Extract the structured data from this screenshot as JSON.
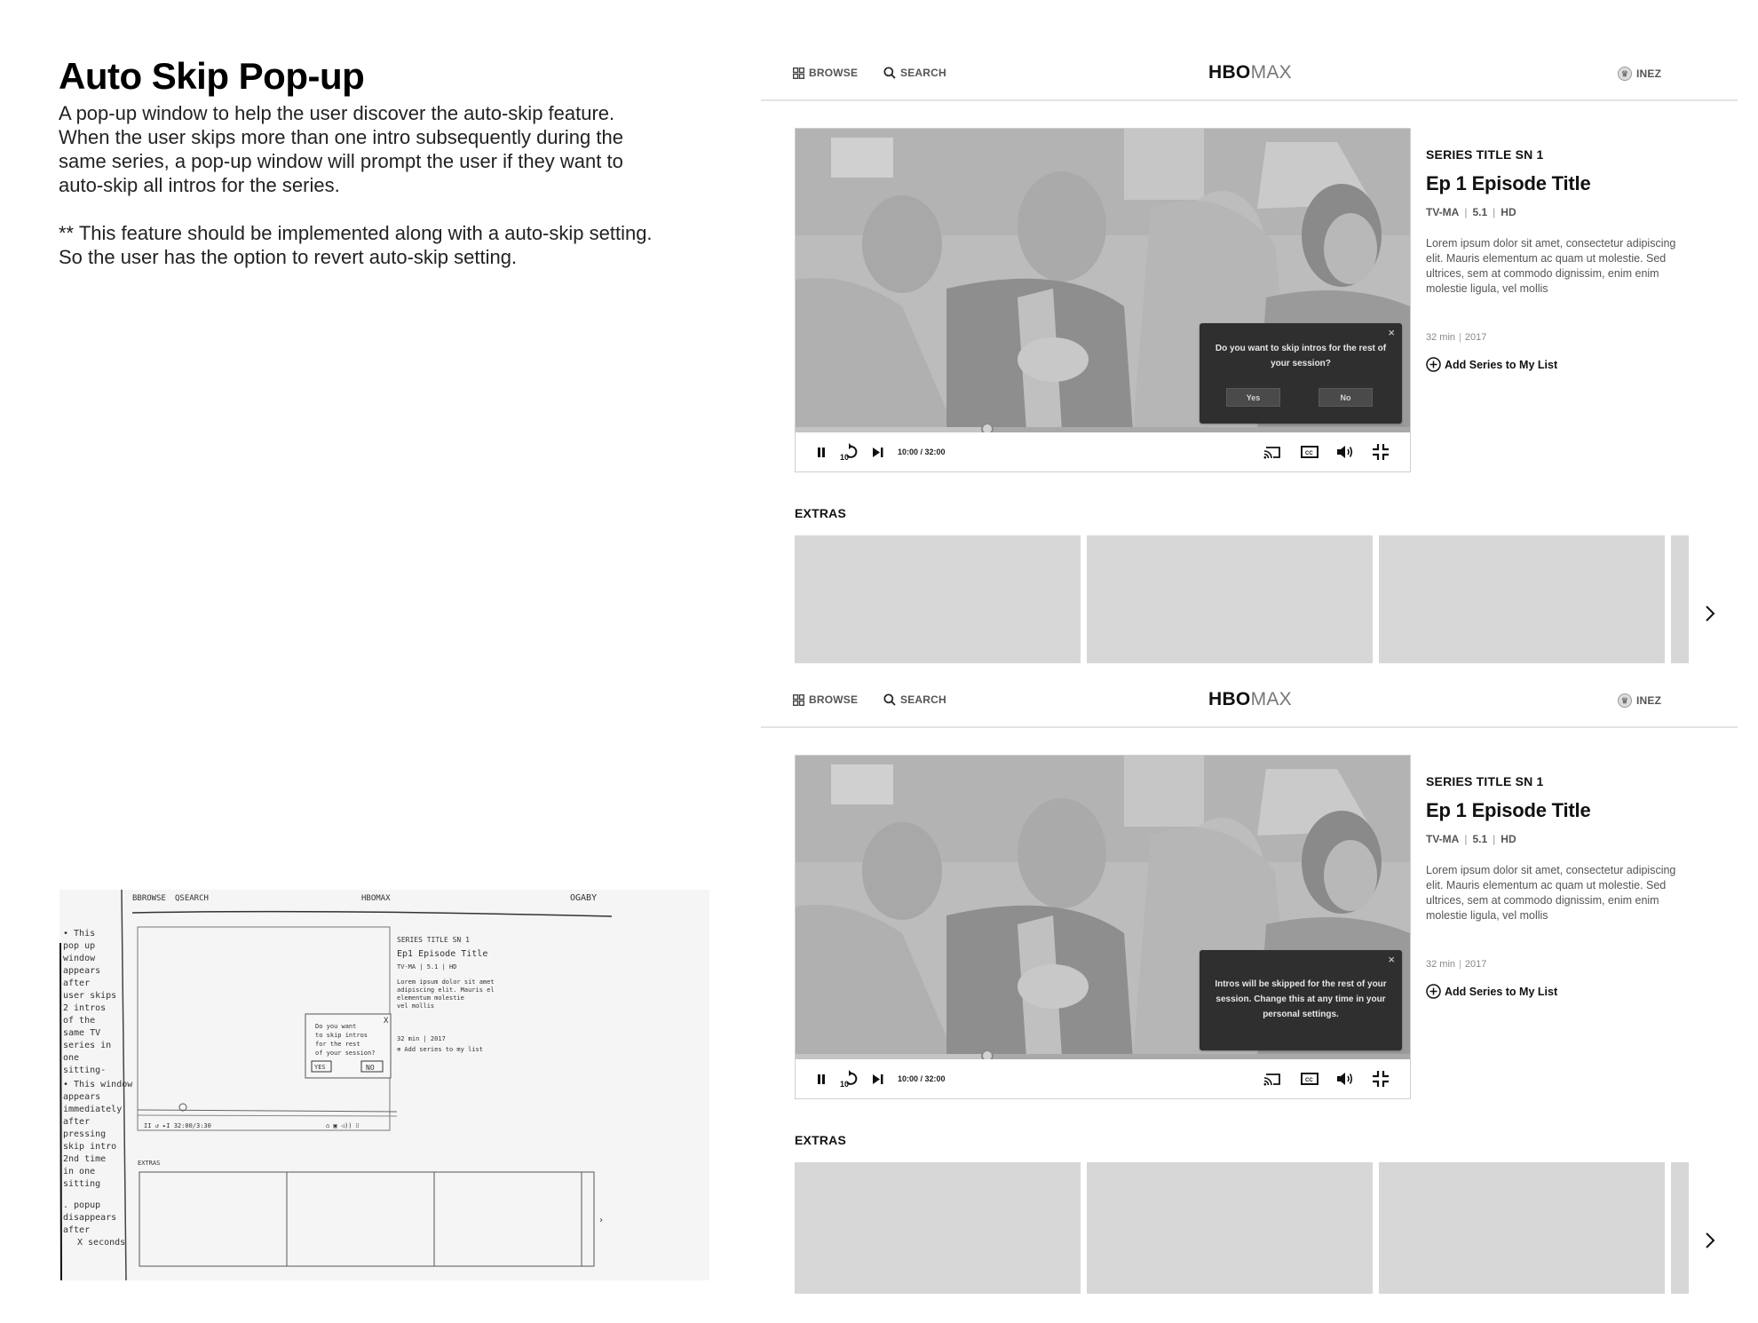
{
  "description": {
    "title": "Auto Skip Pop-up",
    "body": "A pop-up window to help the user discover the auto-skip feature. When the user skips more than one intro subsequently during the same series, a pop-up window will prompt the user if they want to auto-skip all intros for the series.",
    "note": "** This feature should be implemented along with a auto-skip setting. So the user has the option to revert auto-skip setting."
  },
  "sketch": {
    "nav": [
      "BBROWSE",
      "QSEARCH",
      "HBOMAX",
      "OGABY"
    ],
    "notes": [
      "• This pop up window appears after user skips 2 intros of the same TV series in one sitting-",
      "• This window appears immediately after pressing skip intro 2nd time in one sitting",
      "• popup disappears after X seconds"
    ],
    "popup_text": "Do you want to skip intros for the rest of your session?",
    "popup_yes": "YES",
    "popup_no": "NO",
    "extras": "EXTRAS"
  },
  "mockups": [
    {
      "nav": {
        "browse": "BROWSE",
        "search": "SEARCH",
        "logo_bold": "HBO",
        "logo_light": "MAX",
        "user": "INEZ"
      },
      "player": {
        "time": "10:00 / 32:00",
        "progress_fraction": 0.3125,
        "icons": [
          "pause-icon",
          "replay-10-icon",
          "skip-next-icon",
          "cast-icon",
          "closed-captions-icon",
          "volume-icon",
          "exit-fullscreen-icon"
        ]
      },
      "popup": {
        "type": "prompt",
        "message": "Do you want to skip intros for the rest of your session?",
        "yes": "Yes",
        "no": "No",
        "close": "×"
      },
      "info": {
        "series": "SERIES TITLE SN 1",
        "episode": "Ep 1 Episode Title",
        "rating": "TV-MA",
        "audio": "5.1",
        "quality": "HD",
        "synopsis": "Lorem ipsum dolor sit amet, consectetur adipiscing elit. Mauris elementum ac quam ut molestie. Sed ultrices, sem at commodo dignissim, enim enim molestie ligula, vel mollis",
        "runtime": "32 min",
        "year": "2017",
        "add_list": "Add Series to My List"
      },
      "extras": {
        "label": "EXTRAS",
        "tile_count": 4
      }
    },
    {
      "nav": {
        "browse": "BROWSE",
        "search": "SEARCH",
        "logo_bold": "HBO",
        "logo_light": "MAX",
        "user": "INEZ"
      },
      "player": {
        "time": "10:00 / 32:00",
        "progress_fraction": 0.3125
      },
      "popup": {
        "type": "confirmation",
        "message": "Intros will be skipped for the rest of your session. Change this at any time in your personal settings.",
        "close": "×"
      },
      "info": {
        "series": "SERIES TITLE SN 1",
        "episode": "Ep 1 Episode Title",
        "rating": "TV-MA",
        "audio": "5.1",
        "quality": "HD",
        "synopsis": "Lorem ipsum dolor sit amet, consectetur adipiscing elit. Mauris elementum ac quam ut molestie. Sed ultrices, sem at commodo dignissim, enim enim molestie ligula, vel mollis",
        "runtime": "32 min",
        "year": "2017",
        "add_list": "Add Series to My List"
      },
      "extras": {
        "label": "EXTRAS",
        "tile_count": 4
      }
    }
  ],
  "colors": {
    "popup_bg": "#2f2f2f",
    "tile": "#d7d7d7",
    "divider": "#e3e3e3"
  }
}
